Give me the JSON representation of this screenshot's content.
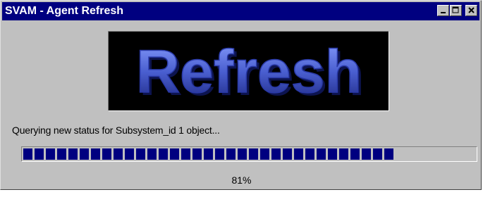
{
  "window": {
    "title": "SVAM - Agent Refresh"
  },
  "logo": {
    "text": "Refresh",
    "background": "#000000",
    "text_color": "#4a5fd0"
  },
  "status": {
    "message": "Querying new status for Subsystem_id  1 object..."
  },
  "progress": {
    "percent": 81,
    "percent_label": "81%",
    "fill_color": "#000080"
  },
  "titlebar_buttons": [
    "minimize-icon",
    "maximize-icon",
    "close-icon"
  ]
}
